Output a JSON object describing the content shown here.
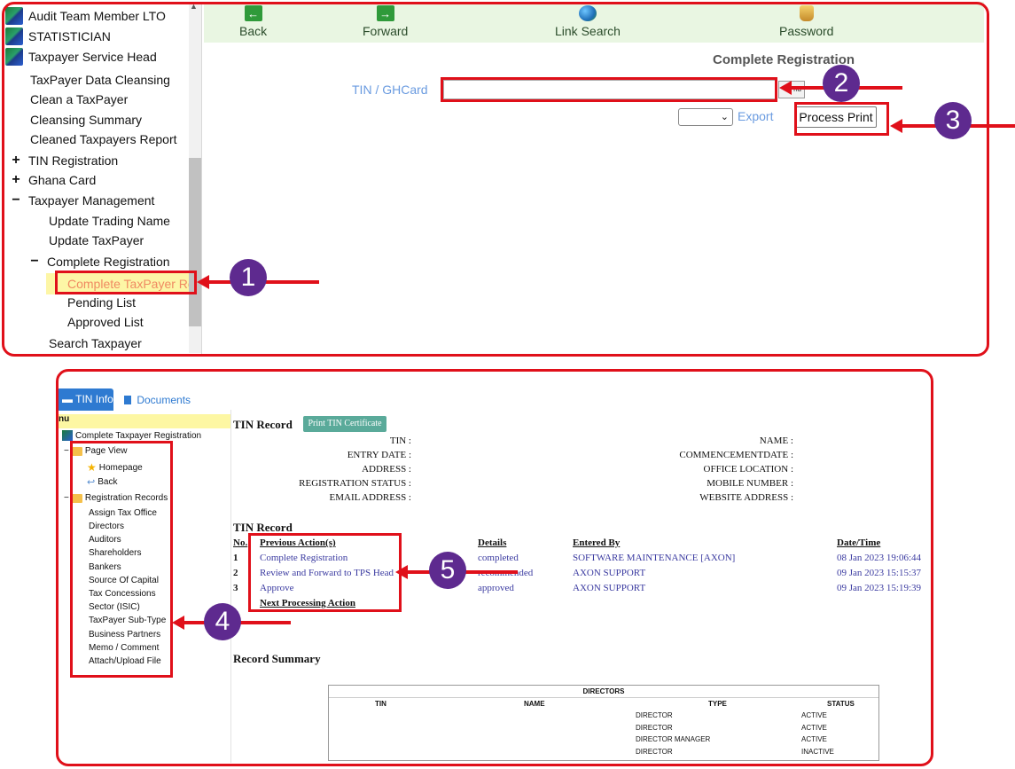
{
  "top_screen": {
    "sidebar": {
      "items": [
        {
          "label": "Audit Team Member LTO",
          "icon": "leaf-logo-icon",
          "level": 0
        },
        {
          "label": "STATISTICIAN",
          "icon": "leaf-logo-icon",
          "level": 0
        },
        {
          "label": "Taxpayer Service Head",
          "icon": "leaf-logo-icon",
          "level": 0
        },
        {
          "label": "TaxPayer Data Cleansing",
          "level": 1
        },
        {
          "label": "Clean a TaxPayer",
          "level": 1
        },
        {
          "label": "Cleansing Summary",
          "level": 1
        },
        {
          "label": "Cleaned Taxpayers Report",
          "level": 1
        },
        {
          "label": "TIN Registration",
          "toggle": "+",
          "level": 0
        },
        {
          "label": "Ghana Card",
          "toggle": "+",
          "level": 0
        },
        {
          "label": "Taxpayer Management",
          "toggle": "−",
          "level": 0
        },
        {
          "label": "Update Trading Name",
          "level": 2
        },
        {
          "label": "Update TaxPayer",
          "level": 2
        },
        {
          "label": "Complete Registration",
          "toggle": "−",
          "level": 2
        },
        {
          "label": "Complete TaxPayer Re",
          "level": 3,
          "selected": true
        },
        {
          "label": "Pending List",
          "level": 3
        },
        {
          "label": "Approved List",
          "level": 3
        },
        {
          "label": "Search Taxpayer",
          "level": 2
        }
      ]
    },
    "toolbar": {
      "back": "Back",
      "forward": "Forward",
      "link_search": "Link Search",
      "password": "Password"
    },
    "main": {
      "heading": "Complete Registration",
      "tin_label": "TIN / GHCard",
      "tin_value": "",
      "find_label": "nd",
      "export_select_value": "",
      "export_label": "Export",
      "process_print_label": "Process Print"
    }
  },
  "bottom_screen": {
    "tabs": {
      "tin_info": "TIN Info",
      "documents": "Documents"
    },
    "tree": {
      "header": "nu",
      "root": "Complete Taxpayer Registration",
      "page_view": "Page View",
      "homepage": "Homepage",
      "back": "Back",
      "registration_records": "Registration Records",
      "records": [
        "Assign Tax Office",
        "Directors",
        "Auditors",
        "Shareholders",
        "Bankers",
        "Source Of Capital",
        "Tax Concessions",
        "Sector (ISIC)",
        "TaxPayer Sub-Type",
        "Business Partners",
        "Memo / Comment",
        "Attach/Upload File"
      ]
    },
    "tin_record": {
      "title": "TIN Record",
      "print_button": "Print TIN Certificate",
      "left_fields": [
        "TIN :",
        "ENTRY DATE :",
        "ADDRESS :",
        "REGISTRATION STATUS :",
        "EMAIL ADDRESS :"
      ],
      "right_fields": [
        "NAME :",
        "COMMENCEMENTDATE :",
        "OFFICE LOCATION :",
        "MOBILE NUMBER :",
        "WEBSITE ADDRESS :"
      ]
    },
    "history": {
      "title": "TIN Record",
      "headers": {
        "no": "No.",
        "action": "Previous Action(s)",
        "details": "Details",
        "entered_by": "Entered By",
        "datetime": "Date/Time"
      },
      "rows": [
        {
          "no": "1",
          "action": "Complete Registration",
          "details": "completed",
          "entered_by": "SOFTWARE MAINTENANCE [AXON]",
          "datetime": "08 Jan 2023 19:06:44"
        },
        {
          "no": "2",
          "action": "Review and Forward to TPS Head",
          "details": "recommended",
          "entered_by": "AXON SUPPORT",
          "datetime": "09 Jan 2023 15:15:37"
        },
        {
          "no": "3",
          "action": "Approve",
          "details": "approved",
          "entered_by": "AXON SUPPORT",
          "datetime": "09 Jan 2023 15:19:39"
        }
      ],
      "next_action": "Next Processing Action"
    },
    "summary": {
      "title": "Record Summary",
      "directors_title": "DIRECTORS",
      "headers": [
        "TIN",
        "NAME",
        "TYPE",
        "STATUS"
      ],
      "rows": [
        {
          "type": "DIRECTOR",
          "status": "ACTIVE"
        },
        {
          "type": "DIRECTOR",
          "status": "ACTIVE"
        },
        {
          "type": "DIRECTOR MANAGER",
          "status": "ACTIVE"
        },
        {
          "type": "DIRECTOR",
          "status": "INACTIVE"
        }
      ]
    }
  },
  "annotations": {
    "badges": [
      "1",
      "2",
      "3",
      "4",
      "5"
    ],
    "color": "#e0101a",
    "badge_color": "#5e2a8f"
  }
}
